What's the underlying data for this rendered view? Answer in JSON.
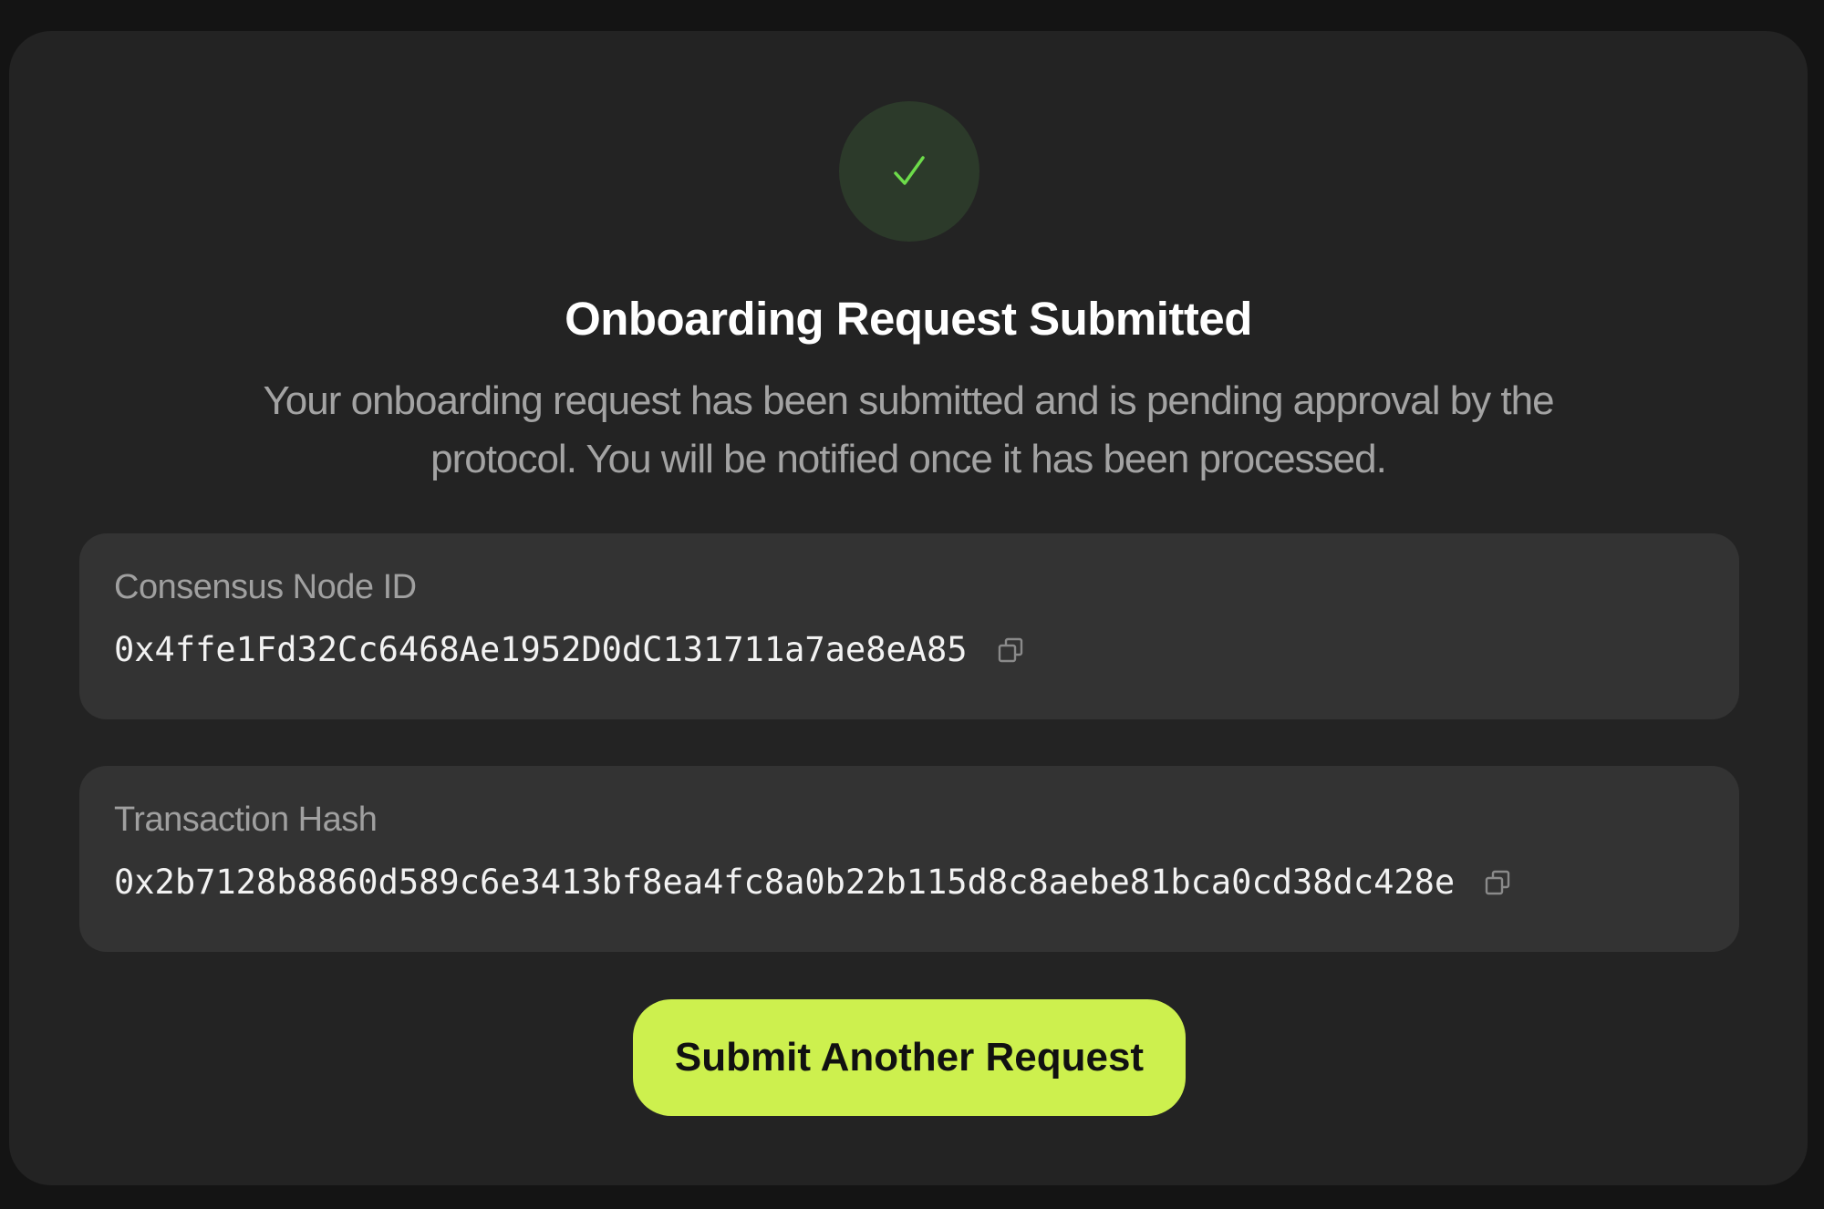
{
  "status": {
    "icon": "checkmark-icon",
    "accent_color": "#6ddc4a",
    "badge_color": "#2c3a2a"
  },
  "title": "Onboarding Request Submitted",
  "description": "Your onboarding request has been submitted and is pending approval by the protocol. You will be notified once it has been processed.",
  "consensus_node": {
    "label": "Consensus Node ID",
    "value": "0x4ffe1Fd32Cc6468Ae1952D0dC131711a7ae8eA85",
    "copy_icon": "copy-icon"
  },
  "transaction": {
    "label": "Transaction Hash",
    "value": "0x2b7128b8860d589c6e3413bf8ea4fc8a0b22b115d8c8aebe81bca0cd38dc428e",
    "copy_icon": "copy-icon"
  },
  "actions": {
    "submit_another_label": "Submit Another Request",
    "button_color": "#cdf04e"
  }
}
